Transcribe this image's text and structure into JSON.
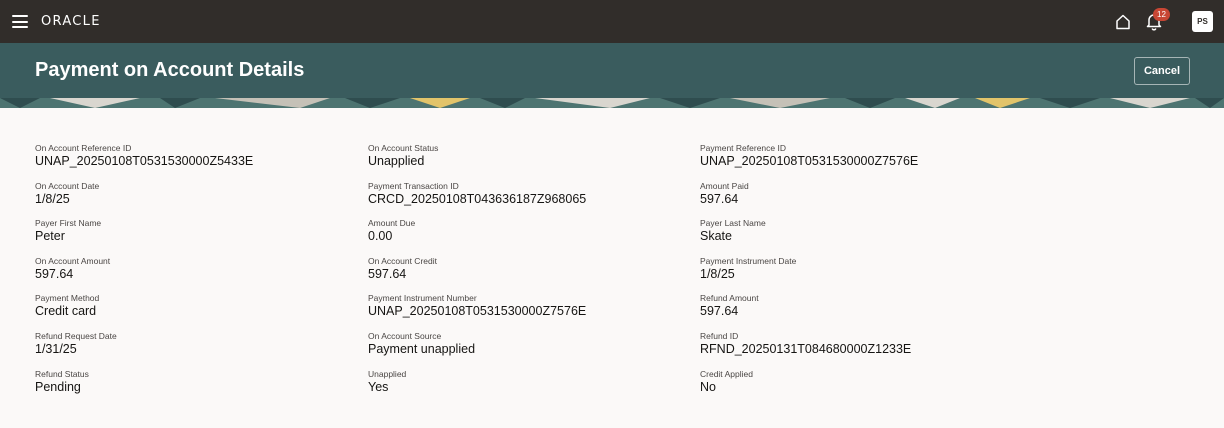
{
  "topbar": {
    "brand": "ORACLE",
    "notification_count": "12",
    "avatar_initials": "PS"
  },
  "header": {
    "title": "Payment on Account Details",
    "cancel_label": "Cancel"
  },
  "columns": [
    [
      {
        "label": "On Account Reference ID",
        "value": "UNAP_20250108T0531530000Z5433E"
      },
      {
        "label": "On Account Date",
        "value": "1/8/25"
      },
      {
        "label": "Payer First Name",
        "value": "Peter"
      },
      {
        "label": "On Account Amount",
        "value": "597.64"
      },
      {
        "label": "Payment Method",
        "value": "Credit card"
      },
      {
        "label": "Refund Request Date",
        "value": "1/31/25"
      },
      {
        "label": "Refund Status",
        "value": "Pending"
      }
    ],
    [
      {
        "label": "On Account Status",
        "value": "Unapplied"
      },
      {
        "label": "Payment Transaction ID",
        "value": "CRCD_20250108T043636187Z968065"
      },
      {
        "label": "Amount Due",
        "value": "0.00"
      },
      {
        "label": "On Account Credit",
        "value": "597.64"
      },
      {
        "label": "Payment Instrument Number",
        "value": "UNAP_20250108T0531530000Z7576E"
      },
      {
        "label": "On Account Source",
        "value": "Payment unapplied"
      },
      {
        "label": "Unapplied",
        "value": "Yes"
      }
    ],
    [
      {
        "label": "Payment Reference ID",
        "value": "UNAP_20250108T0531530000Z7576E"
      },
      {
        "label": "Amount Paid",
        "value": "597.64"
      },
      {
        "label": "Payer Last Name",
        "value": "Skate"
      },
      {
        "label": "Payment Instrument Date",
        "value": "1/8/25"
      },
      {
        "label": "Refund Amount",
        "value": "597.64"
      },
      {
        "label": "Refund ID",
        "value": "RFND_20250131T084680000Z1233E"
      },
      {
        "label": "Credit Applied",
        "value": "No"
      }
    ]
  ]
}
